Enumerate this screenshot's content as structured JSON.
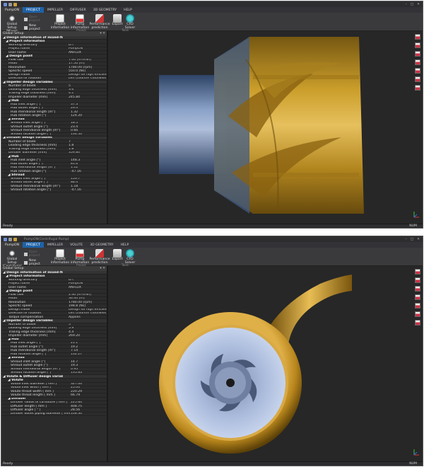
{
  "top": {
    "title": "",
    "tabs": [
      "PumpON",
      "PROJECT",
      "IMPELLER",
      "DIFFUSER",
      "3D GEOMETRY",
      "HELP"
    ],
    "active_tab": 1,
    "ribbon": {
      "setup_label": "Global Setup (Mixed-flow Pump)",
      "open_project": "Open project",
      "new_project": "New project",
      "project_info": "Project information",
      "pump_info": "Pump information",
      "perf_pred": "Performance prediction",
      "export": "Export",
      "cfd_solver": "CFD Solver",
      "group_project": "Project",
      "group_tools": "Tools"
    },
    "panel_title": "Global Setup",
    "rows": [
      {
        "t": "sec",
        "k": "◢ Design information of mixed-flow pump",
        "v": ""
      },
      {
        "t": "sub",
        "k": "◢ Project information",
        "v": ""
      },
      {
        "t": "item",
        "k": "Working directory",
        "v": "D:\\"
      },
      {
        "t": "item",
        "k": "Project name",
        "v": "PumpON"
      },
      {
        "t": "item",
        "k": "User name",
        "v": "ANFLUX"
      },
      {
        "t": "sub",
        "k": "◢ Design point",
        "v": ""
      },
      {
        "t": "item",
        "k": "Flow rate",
        "v": "7.00 [m³/min]"
      },
      {
        "t": "item",
        "k": "Head",
        "v": "17.50 [m]"
      },
      {
        "t": "item",
        "k": "Revolution",
        "v": "1780.00 [rpm]"
      },
      {
        "t": "item",
        "k": "Specific speed",
        "v": "550.0 [Ns]"
      },
      {
        "t": "item",
        "k": "Design mode",
        "v": "Design for high efficiency pump"
      },
      {
        "t": "item",
        "k": "Direction of rotation",
        "v": "Left (counter clockwise)"
      },
      {
        "t": "sec",
        "k": "◢ Impeller design variables",
        "v": ""
      },
      {
        "t": "item",
        "k": "Number of blade",
        "v": "5"
      },
      {
        "t": "item",
        "k": "Leading edge thickness [mm]",
        "v": "3.6"
      },
      {
        "t": "item",
        "k": "Trailing edge thickness [mm]",
        "v": "4.1"
      },
      {
        "t": "item",
        "k": "Impeller diameter [mm]",
        "v": "245.84"
      },
      {
        "t": "sub2",
        "k": "◢ Hub",
        "v": ""
      },
      {
        "t": "item2",
        "k": "Hub inlet angle [°]",
        "v": "37.3"
      },
      {
        "t": "item2",
        "k": "Hub outlet angle [°]",
        "v": "29.4"
      },
      {
        "t": "item2",
        "k": "Hub meridional length [m°]",
        "v": "1.32"
      },
      {
        "t": "item2",
        "k": "Hub rotation angle [°]",
        "v": "124.20"
      },
      {
        "t": "sub2",
        "k": "◢ Shroud",
        "v": ""
      },
      {
        "t": "item2",
        "k": "Shroud inlet angle [°]",
        "v": "18.5"
      },
      {
        "t": "item2",
        "k": "Shroud outlet angle [°]",
        "v": "23.4"
      },
      {
        "t": "item2",
        "k": "Shroud meridional length [m°]",
        "v": "0.66"
      },
      {
        "t": "item2",
        "k": "Shroud rotation angle [°]",
        "v": "134.50"
      },
      {
        "t": "sec",
        "k": "◢ Diffuser design variables",
        "v": ""
      },
      {
        "t": "item",
        "k": "Number of blade",
        "v": "7"
      },
      {
        "t": "item",
        "k": "Leading edge thickness [mm]",
        "v": "1.8"
      },
      {
        "t": "item",
        "k": "Trailing edge thickness [mm]",
        "v": "1.8"
      },
      {
        "t": "item",
        "k": "Diffuser diameter [mm]",
        "v": "359.80"
      },
      {
        "t": "sub2",
        "k": "◢ Hub",
        "v": ""
      },
      {
        "t": "item2",
        "k": "Hub inlet angle [°]",
        "v": "148.3"
      },
      {
        "t": "item2",
        "k": "Hub outlet angle [°]",
        "v": "81.6"
      },
      {
        "t": "item2",
        "k": "Hub meridional length [m°]",
        "v": "1.12"
      },
      {
        "t": "item2",
        "k": "Hub rotation angle [°]",
        "v": "-47.16"
      },
      {
        "t": "sub2",
        "k": "◢ Shroud",
        "v": ""
      },
      {
        "t": "item2",
        "k": "Shroud inlet angle [°]",
        "v": "153.7"
      },
      {
        "t": "item2",
        "k": "Shroud outlet angle [°]",
        "v": "88.4"
      },
      {
        "t": "item2",
        "k": "Shroud meridional length [m°]",
        "v": "1.18"
      },
      {
        "t": "item2",
        "k": "Shroud rotation angle [°]",
        "v": "-47.16"
      }
    ],
    "status": "Ready",
    "num": "NUM"
  },
  "bottom": {
    "title": "PumpON(Centrifugal Pump)",
    "tabs": [
      "PumpON",
      "PROJECT",
      "IMPELLER",
      "VOLUTE",
      "3D GEOMETRY",
      "HELP"
    ],
    "active_tab": 1,
    "ribbon": {
      "setup_label": "Global Setup (Centrifugal Pump)",
      "open_project": "Open project",
      "new_project": "New project",
      "project_info": "Project information",
      "pump_info": "Pump information",
      "perf_pred": "Performance prediction",
      "export": "Export",
      "cfd_solver": "CFD Solver",
      "group_project": "Project",
      "group_tools": "Tools"
    },
    "panel_title": "Global Setup",
    "rows": [
      {
        "t": "sec",
        "k": "◢ Design information of mixed-flow pump",
        "v": ""
      },
      {
        "t": "sub",
        "k": "◢ Project information",
        "v": ""
      },
      {
        "t": "item",
        "k": "Working directory",
        "v": "D:\\"
      },
      {
        "t": "item",
        "k": "Project name",
        "v": "PumpON"
      },
      {
        "t": "item",
        "k": "User name",
        "v": "ANFLUX"
      },
      {
        "t": "sub",
        "k": "◢ Design point",
        "v": ""
      },
      {
        "t": "item",
        "k": "Flow rate",
        "v": "2.40 [m³/min]"
      },
      {
        "t": "item",
        "k": "Head",
        "v": "36.40 [m]"
      },
      {
        "t": "item",
        "k": "Revolution",
        "v": "1780.00 [rpm]"
      },
      {
        "t": "item",
        "k": "Specific speed",
        "v": "198.8 [Ns]"
      },
      {
        "t": "item",
        "k": "Design mode",
        "v": "Design for high efficiency pump"
      },
      {
        "t": "item",
        "k": "Direction of rotation",
        "v": "Left (counter clockwise)"
      },
      {
        "t": "item",
        "k": "Torque compensation",
        "v": "Applies"
      },
      {
        "t": "sec",
        "k": "◢ Impeller design variables",
        "v": ""
      },
      {
        "t": "item",
        "k": "Number of blade",
        "v": "5"
      },
      {
        "t": "item",
        "k": "Leading edge thickness [mm]",
        "v": "5.9"
      },
      {
        "t": "item",
        "k": "Trailing edge thickness [mm]",
        "v": "4.4"
      },
      {
        "t": "item",
        "k": "Impeller diameter [mm]",
        "v": "269.20"
      },
      {
        "t": "sub2",
        "k": "◢ Hub",
        "v": ""
      },
      {
        "t": "item2",
        "k": "Hub inlet angle [°]",
        "v": "21.1"
      },
      {
        "t": "item2",
        "k": "Hub outlet angle [°]",
        "v": "19.2"
      },
      {
        "t": "item2",
        "k": "Hub meridional length [m°]",
        "v": "7.14"
      },
      {
        "t": "item2",
        "k": "Hub rotation angle [°]",
        "v": "132.27"
      },
      {
        "t": "sub2",
        "k": "◢ Shroud",
        "v": ""
      },
      {
        "t": "item2",
        "k": "Shroud inlet angle [°]",
        "v": "14.7"
      },
      {
        "t": "item2",
        "k": "Shroud outlet angle [°]",
        "v": "19.3"
      },
      {
        "t": "item2",
        "k": "Shroud meridional length [m°]",
        "v": "0.95"
      },
      {
        "t": "item2",
        "k": "Shroud rotation angle [°]",
        "v": "135.83"
      },
      {
        "t": "sec",
        "k": "◢ Volute & Diffuser design variables",
        "v": ""
      },
      {
        "t": "sub2",
        "k": "◢ Volute",
        "v": ""
      },
      {
        "t": "item2",
        "k": "Volute inlet diameter [ mm ]",
        "v": "327.00"
      },
      {
        "t": "item2",
        "k": "Volute inlet width [ mm ]",
        "v": "25.00"
      },
      {
        "t": "item2",
        "k": "Volute throat width [ mm ]",
        "v": "220.29"
      },
      {
        "t": "item2",
        "k": "Volute throat length [ mm ]",
        "v": "66.79"
      },
      {
        "t": "sub2",
        "k": "◢ Diffuser",
        "v": ""
      },
      {
        "t": "item2",
        "k": "Diffuser radius of curvature [ mm ]",
        "v": "225.84"
      },
      {
        "t": "item2",
        "k": "Diffuser length [ mm ]",
        "v": "408.75"
      },
      {
        "t": "item2",
        "k": "Diffuser angle [ ° ]",
        "v": "28.56"
      },
      {
        "t": "item2",
        "k": "Diffuser outlet piping diameter [ mm ]",
        "v": "108.30"
      }
    ],
    "status": "Ready",
    "num": "NUM"
  }
}
